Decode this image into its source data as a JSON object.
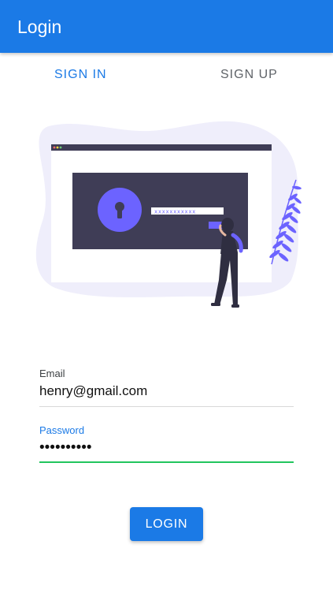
{
  "app_bar": {
    "title": "Login",
    "color": "#1b7ae6"
  },
  "tabs": [
    {
      "label": "SIGN IN",
      "active": true
    },
    {
      "label": "SIGN UP",
      "active": false
    }
  ],
  "illustration": {
    "password_placeholder": "xxxxxxxxxxx",
    "colors": {
      "blob": "#efeefb",
      "screen": "#3f3d56",
      "accent": "#6c63ff"
    }
  },
  "form": {
    "email": {
      "label": "Email",
      "value": "henry@gmail.com"
    },
    "password": {
      "label": "Password",
      "value": "••••••••••"
    },
    "login_button": "LOGIN"
  },
  "colors": {
    "primary": "#1b7ae6",
    "focus_underline": "#22c55e"
  }
}
